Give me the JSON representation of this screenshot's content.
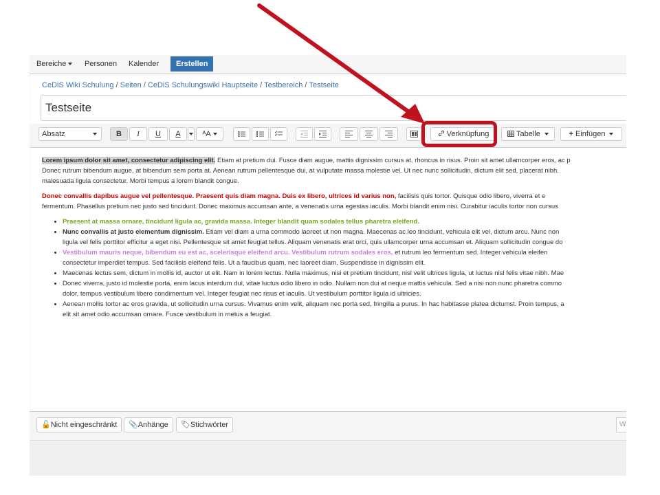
{
  "topnav": {
    "items": [
      "Bereiche",
      "Personen",
      "Kalender"
    ],
    "create_label": "Erstellen"
  },
  "breadcrumb": [
    "CeDiS Wiki Schulung",
    "Seiten",
    "CeDiS Schulungswiki Hauptseite",
    "Testbereich",
    "Testseite"
  ],
  "page_title": "Testseite",
  "toolbar": {
    "paragraph_style": "Absatz",
    "bold": "B",
    "italic": "I",
    "underline": "U",
    "color": "A",
    "size": "ᴬA",
    "link_label": "Verknüpfung",
    "table_label": "Tabelle",
    "insert_label": "Einfügen"
  },
  "content": {
    "p1_line1_hl": "Lorem ipsum dolor sit amet, consectetur adipiscing elit.",
    "p1_line1_rest": " Etiam at pretium dui. Fusce diam augue, mattis dignissim cursus at, rhoncus in risus. Proin sit amet ullamcorper eros, ac p",
    "p1_line2": "Donec rutrum bibendum augue, at bibendum sem porta at. Aenean rutrum pellentesque dui, at vulputate massa molestie vel. Ut nec nunc sollicitudin, dictum elit sed, placerat nibh.",
    "p1_line3": "malesuada ligula consectetur. Morbi tempus a lorem blandit congue.",
    "p2_line1_red": "Donec convallis dapibus augue vel pellentesque. Praesent quis diam magna. Duis ex libero, ultrices id varius non,",
    "p2_line1_rest": " facilisis quis tortor. Quisque odio libero, viverra et e",
    "p2_line2": "fermentum. Phasellus pretium nec justo sed tincidunt. Donec maximus accumsan ante, a venenatis urna egestas iaculis. Morbi blandit enim nisi. Curabitur iaculis tortor non cursus",
    "li1_green": "Praesent at massa ornare, tincidunt ligula ac, gravida massa. Integer blandit quam sodales tellus pharetra eleifend.",
    "li2_bold": "Nunc convallis at justo elementum dignissim.",
    "li2_rest": " Etiam vel diam a urna commodo laoreet ut non magna. Maecenas ac leo tincidunt, vehicula elit vel, dictum arcu. Nunc non",
    "li2_line2": "ligula vel felis porttitor efficitur a eget nisi. Pellentesque sit amet feugiat tellus. Aliquam venenatis erat orci, quis ullamcorper urna accumsan et. Aliquam sollicitudin congue do",
    "li3_purple": "Vestibulum mauris neque, bibendum eu est ac, scelerisque eleifend arcu. Vestibulum rutrum sodales eros,",
    "li3_rest": " et rutrum leo fermentum sed. Integer vehicula eleifen",
    "li3_line2": "consectetur imperdiet tempus. Sed facilisis eleifend felis. Ut a faucibus quam, nec laoreet diam. Suspendisse in dignissim elit.",
    "li4": "Maecenas lectus sem, dictum in mollis id, auctor ut elit. Nam in lorem lectus. Nulla maximus, nisi et pretium tincidunt, nisl velit ultrices ligula, ut luctus nisl felis vitae nibh. Mae",
    "li5_line1": "Donec viverra, justo id molestie porta, enim lacus interdum dui, vitae luctus odio libero in odio. Nullam non dui at neque mattis vehicula. Sed a nisi non nunc pharetra commo",
    "li5_line2": "dolor, tempus vestibulum libero condimentum vel. Integer feugiat nec risus et iaculis. Ut vestibulum porttitor ligula id ultricies.",
    "li6_line1": "Aenean mollis tortor ac eros gravida, ut sollicitudin urna cursus. Vivamus enim velit, aliquam nec porta sed, fringilla a purus. In hac habitasse platea dictumst. Proin tempus, a",
    "li6_line2": "elit sit amet odio accumsan ornare. Fusce vestibulum in metus a feugiat."
  },
  "footer": {
    "restrictions": "Nicht eingeschränkt",
    "attachments": "Anhänge",
    "labels": "Stichwörter",
    "search_placeholder": "Wa"
  },
  "colors": {
    "accent": "#3572b0",
    "annotation": "#c0111f",
    "red_text": "#d00000",
    "green_text": "#7aa520",
    "purple_text": "#c77ddb"
  }
}
